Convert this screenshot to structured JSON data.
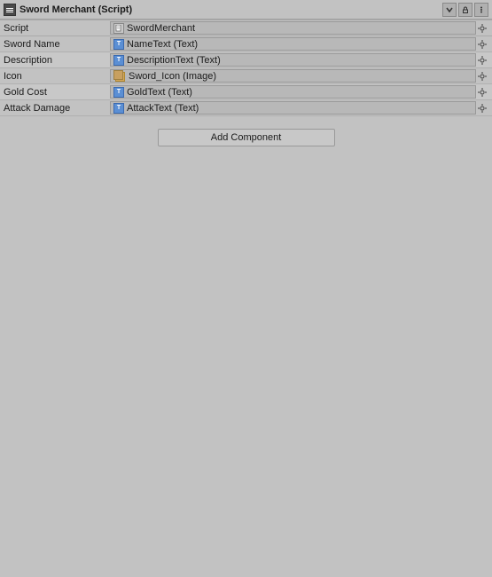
{
  "window": {
    "title": "Sword Merchant (Script)"
  },
  "header": {
    "title": "Sword Merchant (Script)",
    "btn_minus": "▼",
    "btn_lock": "🔒",
    "btn_menu": "⋮"
  },
  "script_row": {
    "label": "Script",
    "value": "SwordMerchant"
  },
  "fields": [
    {
      "label": "Sword Name",
      "icon_type": "text",
      "value": "NameText (Text)"
    },
    {
      "label": "Description",
      "icon_type": "text",
      "value": "DescriptionText (Text)"
    },
    {
      "label": "Icon",
      "icon_type": "image",
      "value": "Sword_Icon (Image)"
    },
    {
      "label": "Gold Cost",
      "icon_type": "text",
      "value": "GoldText (Text)"
    },
    {
      "label": "Attack Damage",
      "icon_type": "text",
      "value": "AttackText (Text)"
    }
  ],
  "add_component_button": "Add Component"
}
